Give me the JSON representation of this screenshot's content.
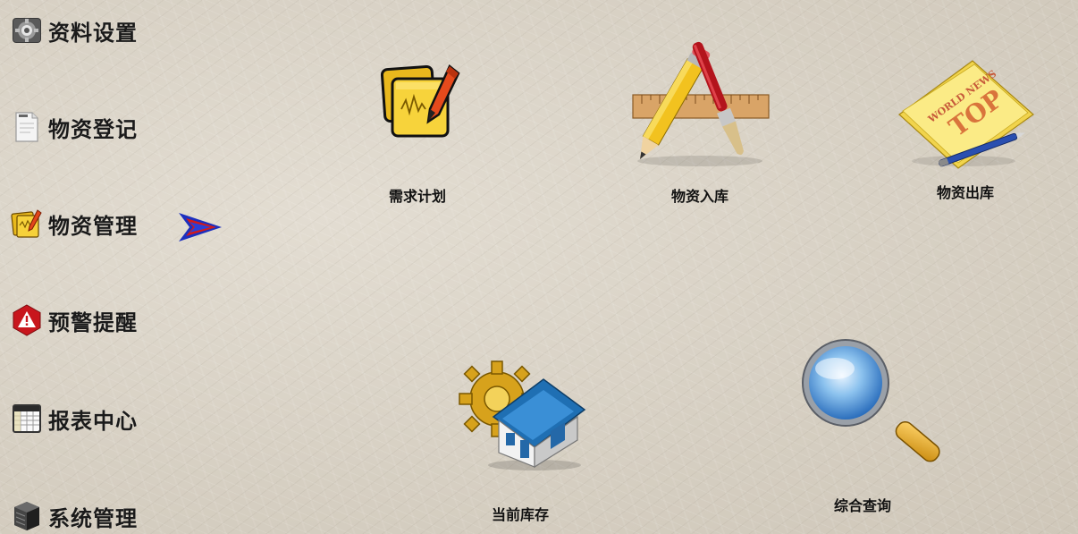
{
  "sidebar": {
    "items": [
      {
        "label": "资料设置",
        "icon": "gear-settings-icon"
      },
      {
        "label": "物资登记",
        "icon": "document-icon"
      },
      {
        "label": "物资管理",
        "icon": "notepad-icon"
      },
      {
        "label": "预警提醒",
        "icon": "warning-icon"
      },
      {
        "label": "报表中心",
        "icon": "spreadsheet-icon"
      },
      {
        "label": "系统管理",
        "icon": "server-icon"
      }
    ],
    "selected_index": 2
  },
  "main": {
    "tiles": [
      {
        "label": "需求计划",
        "icon": "sticky-notes-pen-icon"
      },
      {
        "label": "物资入库",
        "icon": "pencil-ruler-brush-icon"
      },
      {
        "label": "物资出库",
        "icon": "newspaper-icon"
      },
      {
        "label": "当前库存",
        "icon": "gear-house-icon"
      },
      {
        "label": "综合查询",
        "icon": "magnifier-icon"
      }
    ],
    "newspaper_text": {
      "line1": "WORLD NEWS",
      "line2": "TOP"
    }
  },
  "colors": {
    "arrow": "#1b2fbf",
    "arrow_accent": "#d21a1a",
    "warning": "#c8161d"
  }
}
